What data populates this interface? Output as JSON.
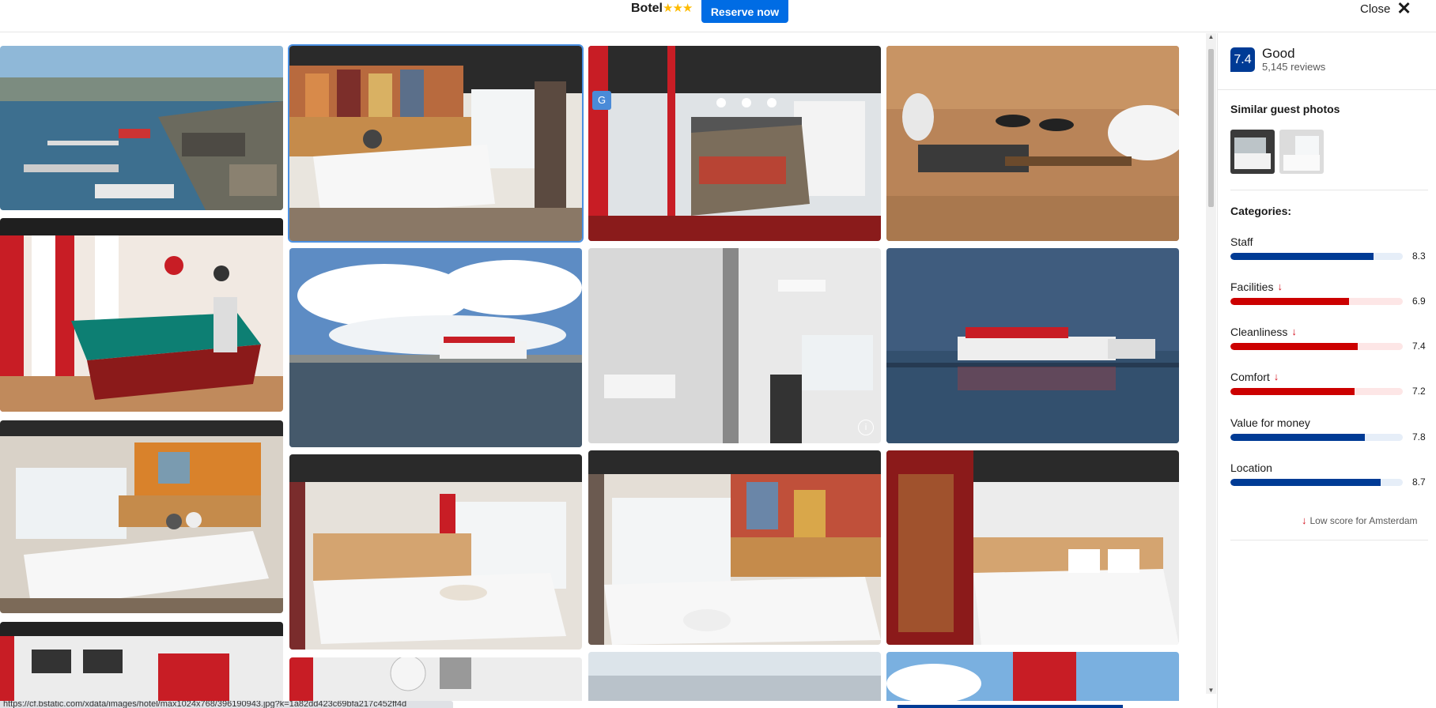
{
  "header": {
    "hotel_name": "Botel",
    "stars": "★★★",
    "reserve_label": "Reserve now",
    "close_label": "Close"
  },
  "review": {
    "score": "7.4",
    "word": "Good",
    "count": "5,145 reviews"
  },
  "similar": {
    "title": "Similar guest photos"
  },
  "categories": {
    "title": "Categories:",
    "items": [
      {
        "label": "Staff",
        "value": "8.3",
        "score": 8.3,
        "low": false,
        "color": "#003b95",
        "track": "#e6eef8"
      },
      {
        "label": "Facilities",
        "value": "6.9",
        "score": 6.9,
        "low": true,
        "color": "#cc0000",
        "track": "#fde6e6"
      },
      {
        "label": "Cleanliness",
        "value": "7.4",
        "score": 7.4,
        "low": true,
        "color": "#cc0000",
        "track": "#fde6e6"
      },
      {
        "label": "Comfort",
        "value": "7.2",
        "score": 7.2,
        "low": true,
        "color": "#cc0000",
        "track": "#fde6e6"
      },
      {
        "label": "Value for money",
        "value": "7.8",
        "score": 7.8,
        "low": false,
        "color": "#003b95",
        "track": "#e6eef8"
      },
      {
        "label": "Location",
        "value": "8.7",
        "score": 8.7,
        "low": false,
        "color": "#003b95",
        "track": "#e6eef8"
      }
    ],
    "low_note": "Low score for Amsterdam"
  },
  "status": {
    "url": "https://cf.bstatic.com/xdata/images/hotel/max1024x768/396190943.jpg?k=1a82dd423c69bfa217c452ff4d"
  }
}
